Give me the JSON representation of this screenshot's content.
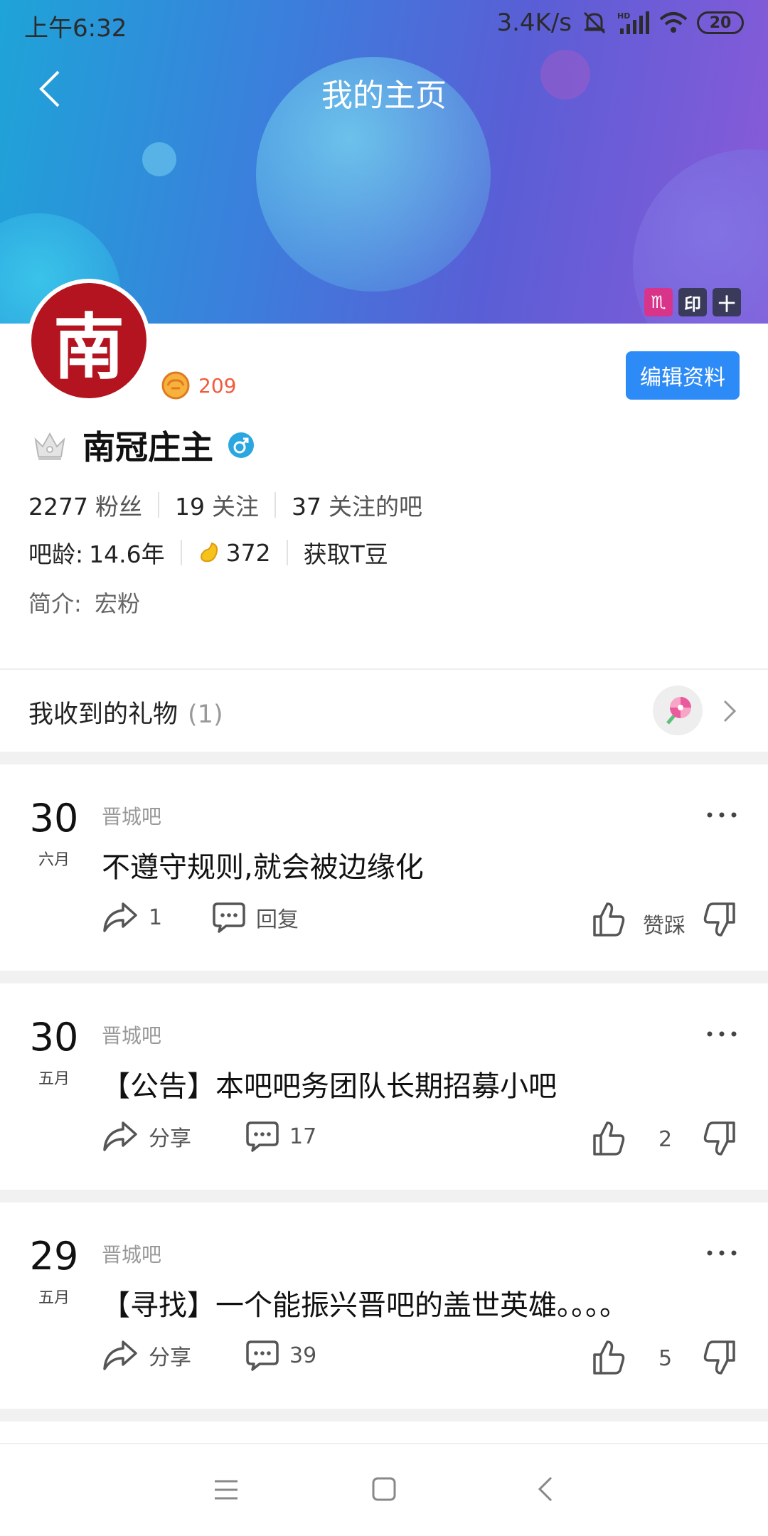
{
  "status_bar": {
    "time": "上午6:32",
    "network_speed": "3.4K/s",
    "network_type": "HD",
    "battery": "20"
  },
  "header": {
    "title": "我的主页",
    "badges": [
      "♏",
      "印",
      "十"
    ]
  },
  "profile": {
    "avatar_char": "南",
    "level_value": "209",
    "edit_label": "编辑资料",
    "username": "南冠庄主",
    "followers_count": "2277",
    "followers_label": "粉丝",
    "following_count": "19",
    "following_label": "关注",
    "bars_count": "37",
    "bars_label": "关注的吧",
    "age_label": "吧龄:",
    "age_value": "14.6年",
    "tdou_value": "372",
    "get_tdou_label": "获取T豆",
    "intro_label": "简介:",
    "intro_value": "宏粉"
  },
  "gifts": {
    "title": "我收到的礼物",
    "count": "(1)"
  },
  "posts": [
    {
      "day": "30",
      "month": "六月",
      "forum": "晋城吧",
      "title": "不遵守规则,就会被边缘化",
      "share_label": "1",
      "comment_label": "回复",
      "like_label": "赞踩"
    },
    {
      "day": "30",
      "month": "五月",
      "forum": "晋城吧",
      "title": "【公告】本吧吧务团队长期招募小吧",
      "share_label": "分享",
      "comment_label": "17",
      "like_label": "2"
    },
    {
      "day": "29",
      "month": "五月",
      "forum": "晋城吧",
      "title": "【寻找】一个能振兴晋吧的盖世英雄。。。。",
      "share_label": "分享",
      "comment_label": "39",
      "like_label": "5"
    }
  ],
  "colors": {
    "accent_blue": "#2c8bf6",
    "level_orange": "#f25a3c",
    "badge_pink": "#d8358a",
    "badge_dark": "#3a3a5a"
  }
}
